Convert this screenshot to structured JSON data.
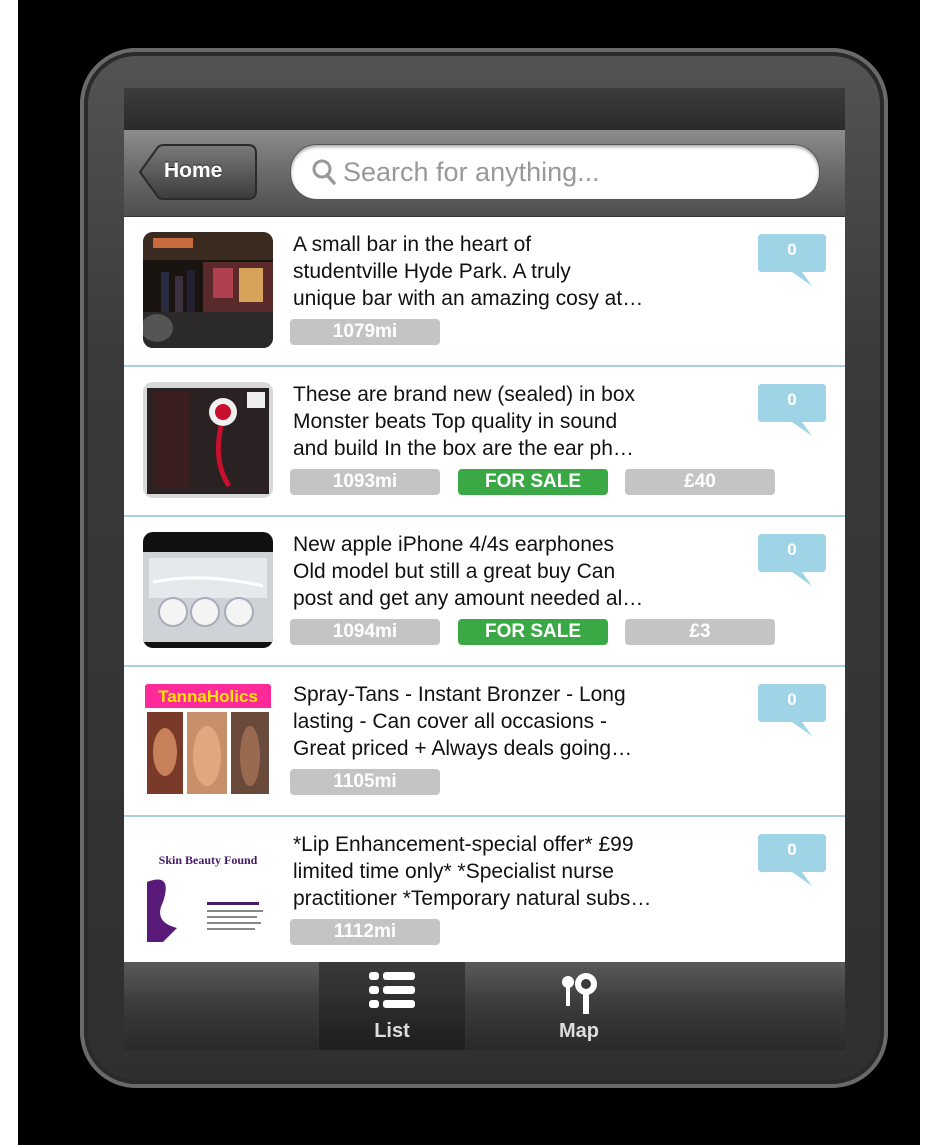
{
  "nav": {
    "back_label": "Home",
    "search_placeholder": "Search for anything..."
  },
  "listings": [
    {
      "lines": [
        "A small bar in the heart of",
        "studentville Hyde Park. A truly",
        "unique bar with an amazing cosy at…"
      ],
      "distance": "1079mi",
      "status": "",
      "price": "",
      "comments": "0",
      "thumb_icon": "bar-photo"
    },
    {
      "lines": [
        "These are brand new (sealed) in box",
        "Monster beats Top quality in sound",
        "and  build  In the box are the ear ph…"
      ],
      "distance": "1093mi",
      "status": "FOR SALE",
      "price": "£40",
      "comments": "0",
      "thumb_icon": "headphones-box-photo"
    },
    {
      "lines": [
        "New apple iPhone 4/4s earphones",
        "Old  model but still a great buy  Can",
        "post  and get any amount needed al…"
      ],
      "distance": "1094mi",
      "status": "FOR SALE",
      "price": "£3",
      "comments": "0",
      "thumb_icon": "earphones-photo"
    },
    {
      "lines": [
        "Spray-Tans  - Instant Bronzer - Long",
        "lasting - Can cover all occasions -",
        "Great priced + Always deals going…"
      ],
      "distance": "1105mi",
      "status": "",
      "price": "",
      "comments": "0",
      "thumb_icon": "spray-tan-photo",
      "thumb_text": "TannaHolics"
    },
    {
      "lines": [
        "*Lip Enhancement-special offer* £99",
        "limited time only*  *Specialist nurse",
        "practitioner *Temporary natural subs…"
      ],
      "distance": "1112mi",
      "status": "",
      "price": "",
      "comments": "0",
      "thumb_icon": "beauty-flyer-photo",
      "thumb_text": "Skin Beauty Found"
    }
  ],
  "tabs": [
    {
      "label": "List",
      "icon": "list-icon",
      "selected": true
    },
    {
      "label": "Map",
      "icon": "map-pin-icon",
      "selected": false
    }
  ],
  "colors": {
    "accent_blue": "#9fd4e6",
    "sale_green": "#3aa844",
    "tag_gray": "#c4c4c4",
    "divider": "#a9d0e0"
  }
}
